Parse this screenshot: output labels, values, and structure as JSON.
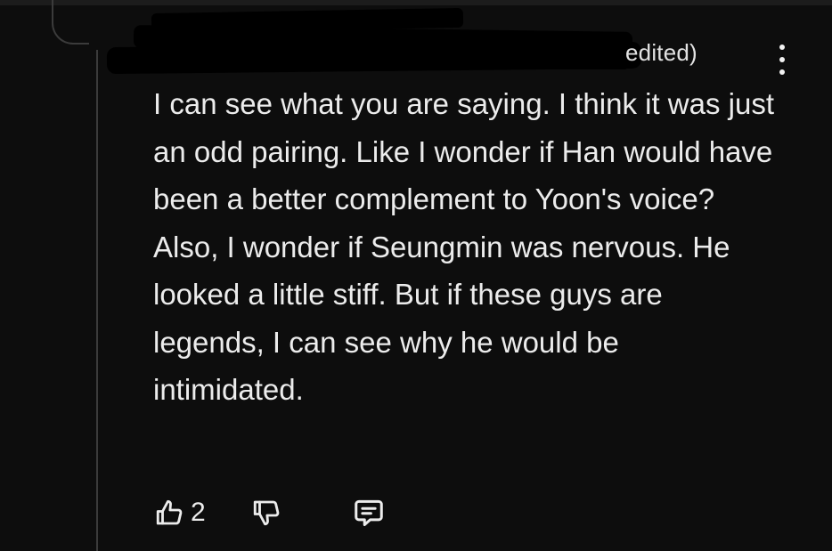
{
  "comment": {
    "edited_label": "edited)",
    "body": "I can see what you are saying. I think it was just an odd pairing. Like I wonder if Han would have been a better complement to Yoon's voice? Also, I wonder if Seungmin was nervous. He looked a little stiff. But if these guys are legends, I can see why he would be intimidated.",
    "upvotes": "2"
  },
  "icons": {
    "menu": "kebab-icon",
    "upvote": "thumbs-up-icon",
    "downvote": "thumbs-down-icon",
    "reply": "reply-icon"
  },
  "colors": {
    "background": "#0d0d0d",
    "text": "#ececec",
    "thread_line": "#3b3b3b"
  }
}
